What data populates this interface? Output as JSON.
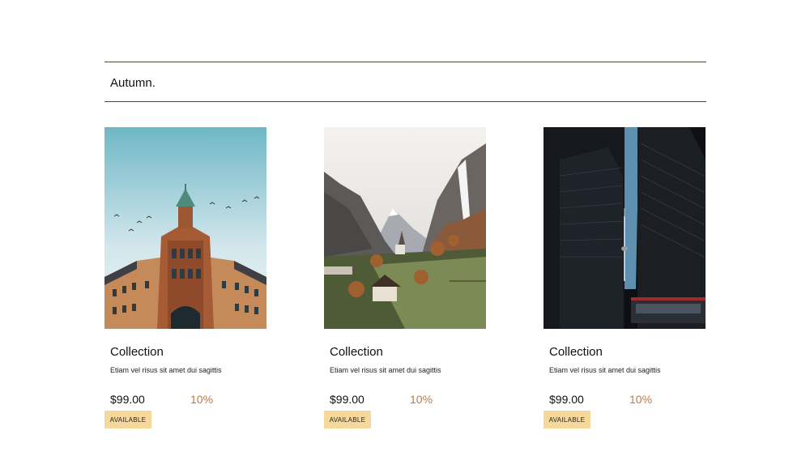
{
  "section": {
    "title": "Autumn."
  },
  "products": [
    {
      "title": "Collection",
      "description": "Etiam vel risus sit amet dui sagittis",
      "price": "$99.00",
      "discount": "10%",
      "status": "AVAILABLE",
      "image": "building-photo"
    },
    {
      "title": "Collection",
      "description": "Etiam vel risus sit amet dui sagittis",
      "price": "$99.00",
      "discount": "10%",
      "status": "AVAILABLE",
      "image": "valley-waterfall-photo"
    },
    {
      "title": "Collection",
      "description": "Etiam vel risus sit amet dui sagittis",
      "price": "$99.00",
      "discount": "10%",
      "status": "AVAILABLE",
      "image": "skyscrapers-photo"
    }
  ],
  "colors": {
    "rule": "#4b4b3b",
    "discount": "#c07a45",
    "badge": "#f6d99a"
  }
}
